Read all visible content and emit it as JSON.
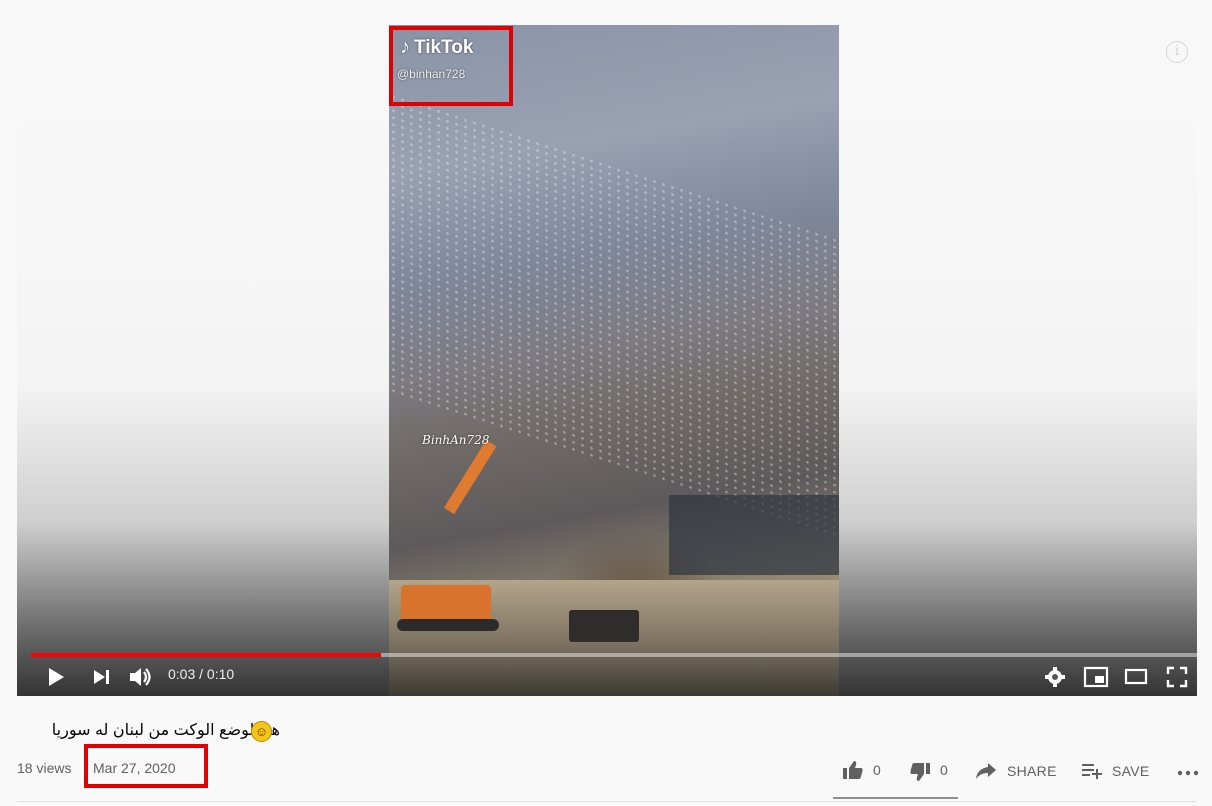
{
  "video": {
    "tiktok_brand": "TikTok",
    "tiktok_handle": "@binhan728",
    "watermark": "BinhAn728"
  },
  "player": {
    "current_time": "0:03",
    "duration": "0:10",
    "time_display": "0:03 / 0:10",
    "progress_fraction": 0.3,
    "icons": [
      "play-icon",
      "next-icon",
      "volume-icon",
      "settings-icon",
      "miniplayer-icon",
      "theater-mode-icon",
      "fullscreen-icon",
      "info-icon"
    ]
  },
  "meta": {
    "title": "هذاالوضع الوكت من لبنان له سوريا",
    "views": "18 views",
    "date": "Mar 27, 2020"
  },
  "actions": {
    "likes": "0",
    "dislikes": "0",
    "share": "SHARE",
    "save": "SAVE"
  },
  "colors": {
    "accent": "#ff0000",
    "highlight_box": "#e00000",
    "text_secondary": "#606060"
  }
}
